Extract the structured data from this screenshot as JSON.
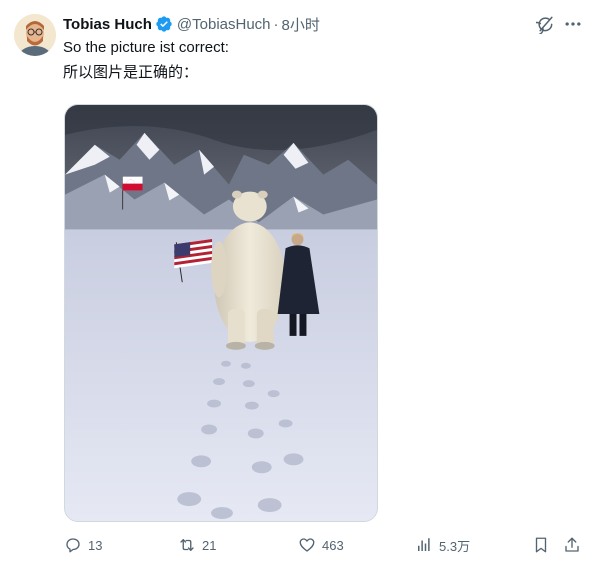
{
  "author": {
    "display_name": "Tobias Huch",
    "handle": "@TobiasHuch",
    "time": "8小时",
    "separator": "·"
  },
  "post": {
    "line1": "So the picture ist correct:",
    "line2": "所以图片是正确的："
  },
  "actions": {
    "replies": "13",
    "reposts": "21",
    "likes": "463",
    "views": "5.3万"
  },
  "colors": {
    "verified_blue": "#1d9bf0",
    "secondary_text": "#536471",
    "primary_text": "#0f1419"
  },
  "icons": [
    "verified-badge-icon",
    "grok-icon",
    "more-icon",
    "reply-icon",
    "repost-icon",
    "like-icon",
    "views-icon",
    "bookmark-icon",
    "share-icon"
  ]
}
